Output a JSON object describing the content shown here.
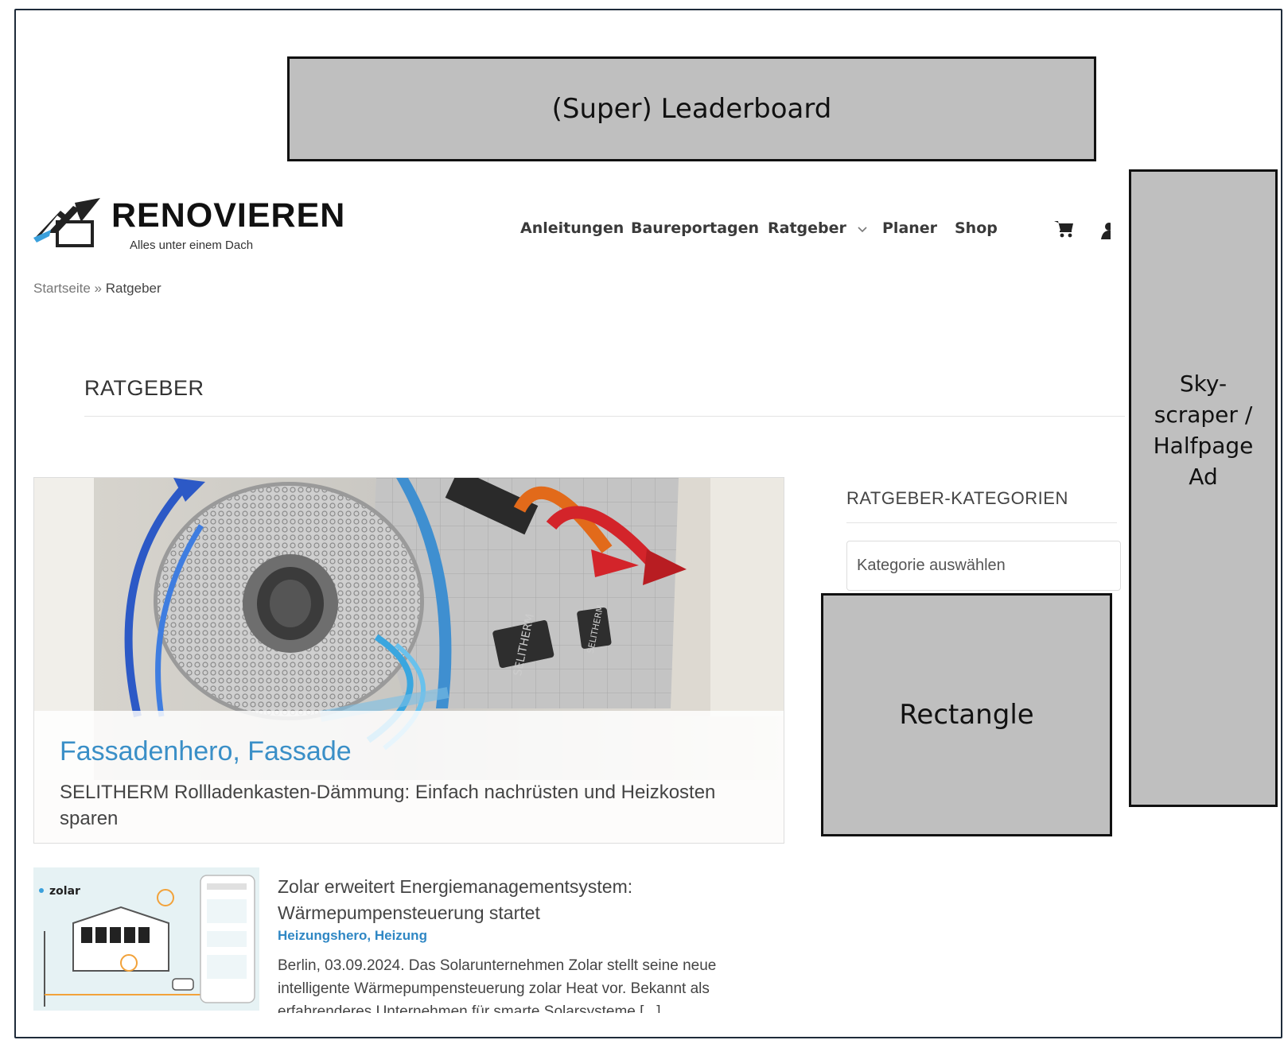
{
  "ads": {
    "leaderboard": "(Super) Leaderboard",
    "skyscraper": "Sky-scraper / Halfpage Ad",
    "rectangle": "Rectangle"
  },
  "header": {
    "logo_name": "RENOVIEREN",
    "logo_tagline": "Alles unter einem Dach",
    "nav": [
      "Anleitungen",
      "Baureportagen",
      "Ratgeber",
      "Planer",
      "Shop"
    ]
  },
  "breadcrumb": {
    "home": "Startseite",
    "separator": " » ",
    "current": "Ratgeber"
  },
  "page": {
    "title": "RATGEBER"
  },
  "hero": {
    "categories": "Fassadenhero, Fassade",
    "title": "SELITHERM Rollladenkasten-Dämmung: Einfach nachrüsten und Heizkosten sparen",
    "image_labels": [
      "SELITHERM",
      "SELITHERM"
    ]
  },
  "sidebar": {
    "title": "RATGEBER-KATEGORIEN",
    "select_placeholder": "Kategorie auswählen"
  },
  "post": {
    "thumb_brand": "zolar",
    "title": "Zolar erweitert Energiemanagementsystem: Wärmepumpensteuerung startet",
    "categories": "Heizungshero, Heizung",
    "excerpt": "Berlin, 03.09.2024. Das Solarunternehmen Zolar stellt seine neue intelligente Wärmepumpensteuerung zolar Heat vor. Bekannt als erfahrenderes Unternehmen für smarte Solarsysteme [...]"
  },
  "colors": {
    "accent_blue": "#3a8fc7",
    "ad_gray": "#bfbfbf",
    "frame": "#1e2b3a"
  }
}
